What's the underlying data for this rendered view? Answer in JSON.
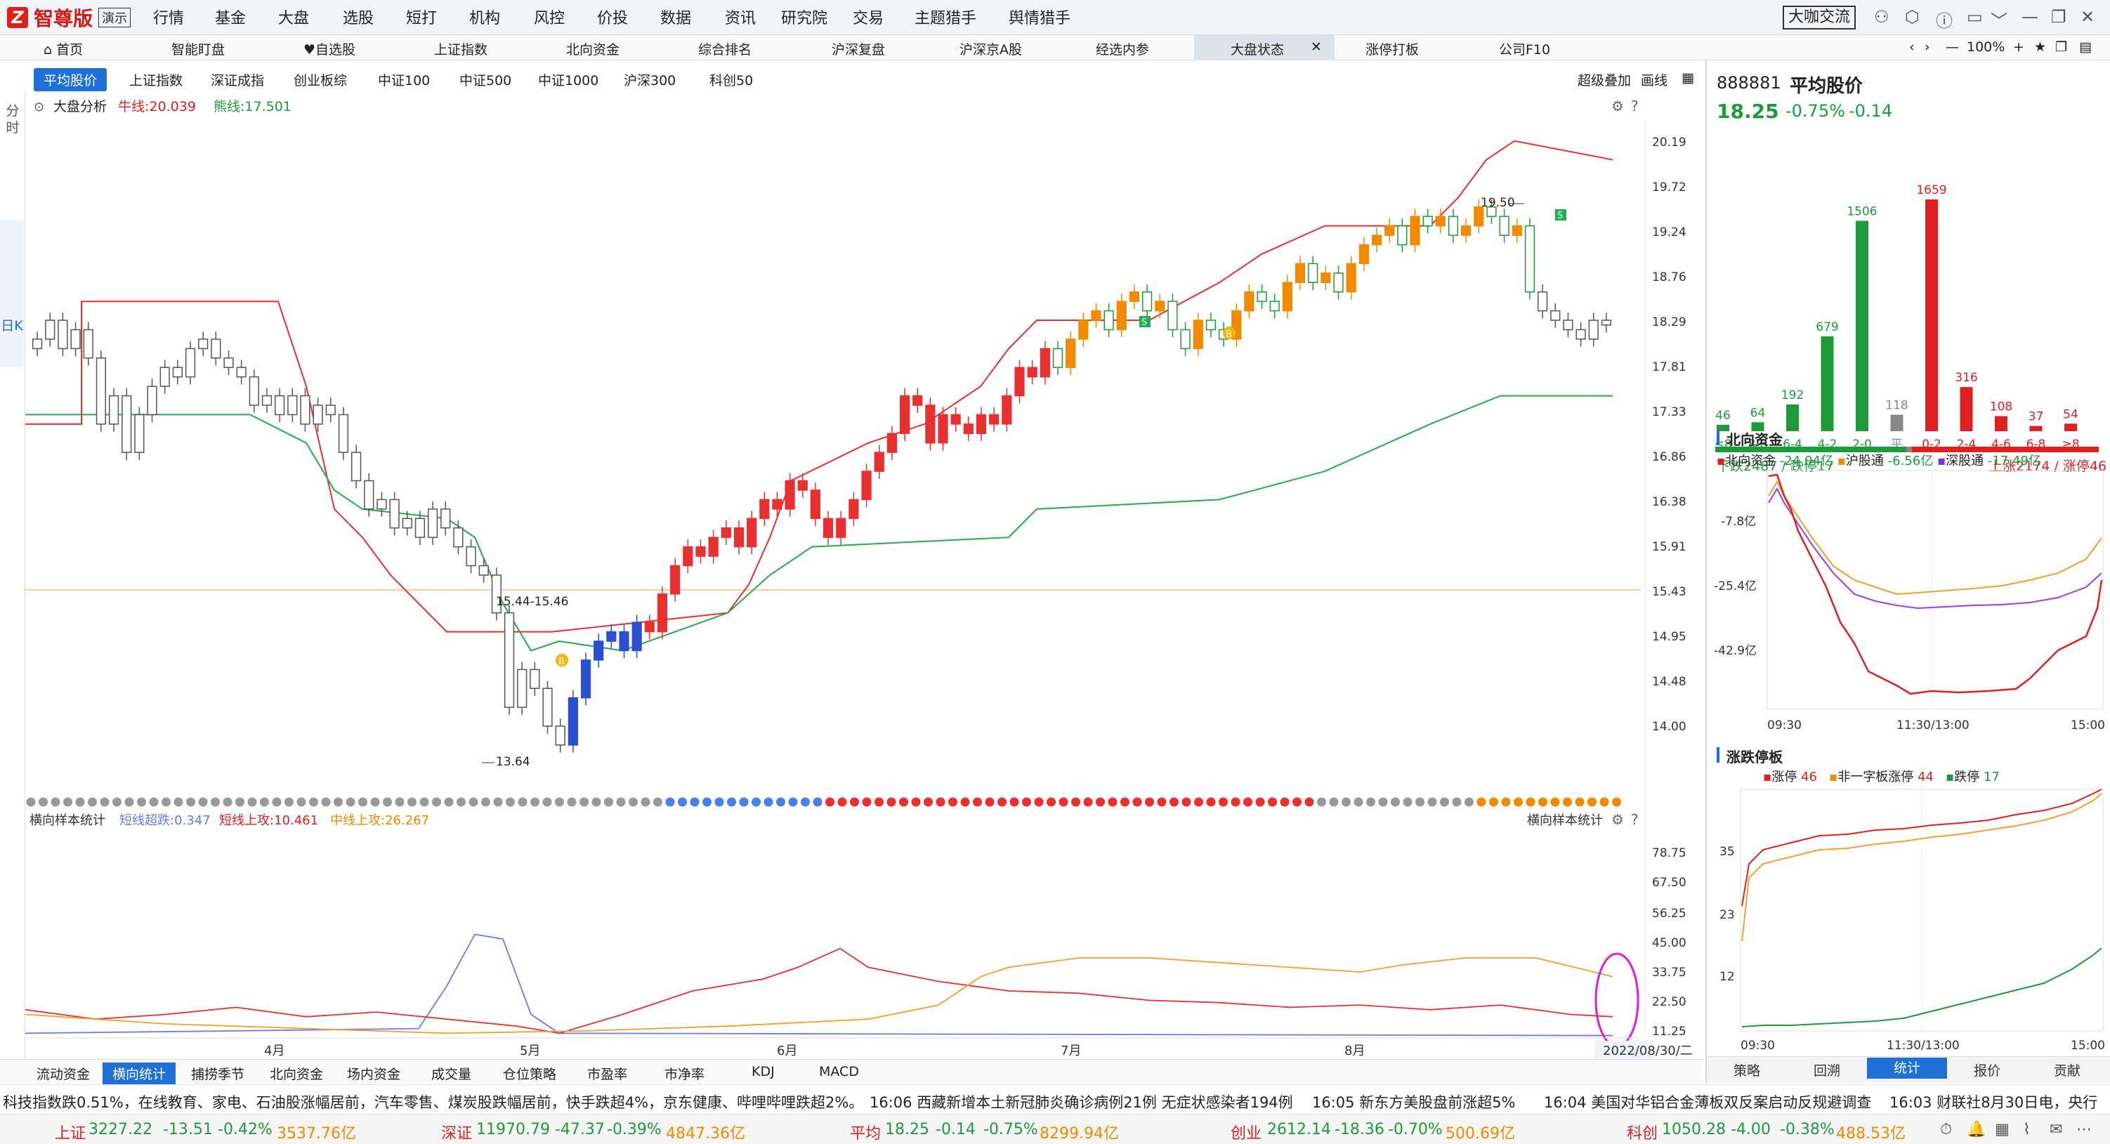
{
  "app": {
    "brand": "智尊版",
    "demo_badge": "演示",
    "menu": [
      "行情",
      "基金",
      "大盘",
      "选股",
      "短打",
      "机构",
      "风控",
      "价投",
      "数据",
      "资讯",
      "研究院",
      "交易",
      "主题猎手",
      "舆情猎手"
    ],
    "exchange_button": "大咖交流",
    "zoom": "100%"
  },
  "tabs": [
    "首页",
    "智能盯盘",
    "自选股",
    "上证指数",
    "北向资金",
    "综合排名",
    "沪深复盘",
    "沪深京A股",
    "经选内参",
    "大盘状态",
    "涨停打板",
    "公司F10"
  ],
  "active_tab": "大盘状态",
  "index_buttons": [
    "平均股价",
    "上证指数",
    "深证成指",
    "创业板综",
    "中证100",
    "中证500",
    "中证1000",
    "沪深300",
    "科创50"
  ],
  "toolbar_right": {
    "overlay": "超级叠加",
    "draw": "画线"
  },
  "left_strip": {
    "fenshi": "分时",
    "rik": "日K"
  },
  "main_chart": {
    "indicator": "大盘分析",
    "bull_label": "牛线:20.039",
    "bear_label": "熊线:17.501",
    "price_ticks": [
      "20.19",
      "19.72",
      "19.24",
      "18.76",
      "18.29",
      "17.81",
      "17.33",
      "16.86",
      "16.38",
      "15.91",
      "15.43",
      "14.95",
      "14.48",
      "14.00"
    ],
    "annotation_high": "19.50",
    "annotation_low": "13.64",
    "annotation_range": "15.44-15.46",
    "buy_mark": "B",
    "sell_mark": "S"
  },
  "sub_chart": {
    "name": "横向样本统计",
    "name_right": "横向样本统计",
    "short_drop": "短线超跌:0.347",
    "short_up": "短线上攻:10.461",
    "mid_up": "中线上攻:26.267",
    "ticks": [
      "78.75",
      "67.50",
      "56.25",
      "45.00",
      "33.75",
      "22.50",
      "11.25"
    ]
  },
  "x_labels": [
    "4月",
    "5月",
    "6月",
    "7月",
    "8月"
  ],
  "date_label": "2022/08/30/二",
  "bottom_tabs": [
    "流动资金",
    "横向统计",
    "捕捞季节",
    "北向资金",
    "场内资金",
    "成交量",
    "仓位策略",
    "市盈率",
    "市净率",
    "KDJ",
    "MACD"
  ],
  "active_bottom_tab": "横向统计",
  "ticker": [
    "科技指数跌0.51%，在线教育、家电、石油股涨幅居前，汽车零售、煤炭股跌幅居前，快手跌超4%，京东健康、哔哩哔哩跌超2%。",
    "16:06 西藏新增本土新冠肺炎确诊病例21例 无症状感染者194例",
    "16:05 新东方美股盘前涨超5%",
    "16:04 美国对华铝合金薄板双反案启动反规避调查",
    "16:03 财联社8月30日电，央行"
  ],
  "status": [
    {
      "name": "上证",
      "value": "3227.22",
      "chg": "-13.51",
      "pct": "-0.42%",
      "amt": "3537.76亿"
    },
    {
      "name": "深证",
      "value": "11970.79",
      "chg": "-47.37",
      "pct": "-0.39%",
      "amt": "4847.36亿"
    },
    {
      "name": "平均",
      "value": "18.25",
      "chg": "-0.14",
      "pct": "-0.75%",
      "amt": "8299.94亿"
    },
    {
      "name": "创业",
      "value": "2612.14",
      "chg": "-18.36",
      "pct": "-0.70%",
      "amt": "500.69亿"
    },
    {
      "name": "科创",
      "value": "1050.28",
      "chg": "-4.00",
      "pct": "-0.38%",
      "amt": "488.53亿"
    }
  ],
  "right": {
    "code": "888881",
    "name": "平均股价",
    "price": "18.25",
    "pct": "-0.75%",
    "chg": "-0.14",
    "dist_values": [
      "46",
      "64",
      "192",
      "679",
      "1506",
      "118",
      "1659",
      "316",
      "108",
      "37",
      "54"
    ],
    "dist_labels": [
      "≤8",
      "8-6",
      "6-4",
      "4-2",
      "2-0",
      "平",
      "0-2",
      "2-4",
      "4-6",
      "6-8",
      "≥8"
    ],
    "down_text": "下跌2487 / 跌停17",
    "up_text": "上涨2174 / 涨停46",
    "north": {
      "title": "北向资金",
      "legend": {
        "north": "北向资金",
        "north_val": "-24.04亿",
        "sh": "沪股通",
        "sh_val": "-6.56亿",
        "sz": "深股通",
        "sz_val": "-17.49亿"
      },
      "ticks": [
        "-7.8亿",
        "-25.4亿",
        "-42.9亿"
      ],
      "times": [
        "09:30",
        "11:30/13:00",
        "15:00"
      ]
    },
    "limit": {
      "title": "涨跌停板",
      "legend": {
        "up": "涨停",
        "up_val": "46",
        "non": "非一字板涨停",
        "non_val": "44",
        "down": "跌停",
        "down_val": "17"
      },
      "ticks": [
        "35",
        "23",
        "12"
      ],
      "times": [
        "09:30",
        "11:30/13:00",
        "15:00"
      ]
    },
    "tabs": [
      "策略",
      "回溯",
      "统计",
      "报价",
      "贡献"
    ],
    "active_tab": "统计"
  },
  "colors": {
    "up": "#e02020",
    "down": "#1e9a3a",
    "orange": "#f08a00",
    "accent": "#1e6fd6"
  }
}
